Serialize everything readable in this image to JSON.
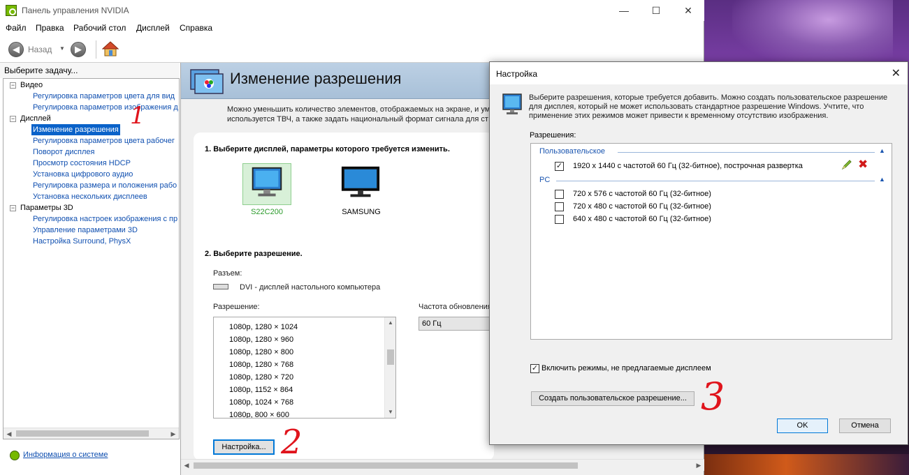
{
  "window": {
    "title": "Панель управления NVIDIA",
    "minimize": "—",
    "maximize": "☐",
    "close": "✕"
  },
  "menu": [
    "Файл",
    "Правка",
    "Рабочий стол",
    "Дисплей",
    "Справка"
  ],
  "toolbar": {
    "back_label": "Назад"
  },
  "tasks": {
    "header": "Выберите задачу...",
    "groups": [
      {
        "label": "Видео",
        "items": [
          "Регулировка параметров цвета для вид",
          "Регулировка параметров изображения д"
        ]
      },
      {
        "label": "Дисплей",
        "items": [
          "Изменение разрешения",
          "Регулировка параметров цвета рабочег",
          "Поворот дисплея",
          "Просмотр состояния HDCP",
          "Установка цифрового аудио",
          "Регулировка размера и положения рабо",
          "Установка нескольких дисплеев"
        ]
      },
      {
        "label": "Параметры 3D",
        "items": [
          "Регулировка настроек изображения с пр",
          "Управление параметрами 3D",
          "Настройка Surround, PhysX"
        ]
      }
    ],
    "selected": "Изменение разрешения",
    "system_info": "Информация о системе"
  },
  "content": {
    "title": "Изменение разрешения",
    "description": "Можно уменьшить количество элементов, отображаемых на экране, и ум используется ТВЧ, а также задать национальный формат сигнала для ст",
    "step1": "1. Выберите дисплей, параметры которого требуется изменить.",
    "monitors": [
      {
        "label": "S22C200",
        "selected": true
      },
      {
        "label": "SAMSUNG",
        "selected": false
      }
    ],
    "step2": "2. Выберите разрешение.",
    "connector_label": "Разъем:",
    "connector_value": "DVI - дисплей настольного компьютера",
    "resolution_label": "Разрешение:",
    "resolutions": [
      "1080p, 1280 × 1024",
      "1080p, 1280 × 960",
      "1080p, 1280 × 800",
      "1080p, 1280 × 768",
      "1080p, 1280 × 720",
      "1080p, 1152 × 864",
      "1080p, 1024 × 768",
      "1080p, 800 × 600"
    ],
    "refresh_label": "Частота обновления",
    "refresh_value": "60 Гц",
    "customize_button": "Настройка..."
  },
  "annotations": {
    "one": "1",
    "two": "2",
    "three": "3"
  },
  "dialog": {
    "title": "Настройка",
    "description": "Выберите разрешения, которые требуется добавить. Можно создать пользовательское разрешение для дисплея, который не может использовать стандартное разрешение Windows. Учтите, что применение этих режимов может привести к временному отсутствию изображения.",
    "resolutions_label": "Разрешения:",
    "custom_group": "Пользовательское",
    "custom_items": [
      {
        "label": "1920 x 1440 с частотой 60 Гц (32-битное), построчная развертка",
        "checked": true
      }
    ],
    "pc_group": "PC",
    "pc_items": [
      {
        "label": "720 x 576 с частотой 60 Гц (32-битное)",
        "checked": false
      },
      {
        "label": "720 x 480 с частотой 60 Гц (32-битное)",
        "checked": false
      },
      {
        "label": "640 x 480 с частотой 60 Гц (32-битное)",
        "checked": false
      }
    ],
    "enable_modes": "Включить режимы, не предлагаемые дисплеем",
    "enable_modes_checked": true,
    "create_custom": "Создать пользовательское разрешение...",
    "ok": "OK",
    "cancel": "Отмена"
  },
  "colors": {
    "accent": "#0a62c9",
    "link": "#0f4fb0",
    "nvidia_green": "#76b900",
    "annotation": "#e0141c"
  }
}
